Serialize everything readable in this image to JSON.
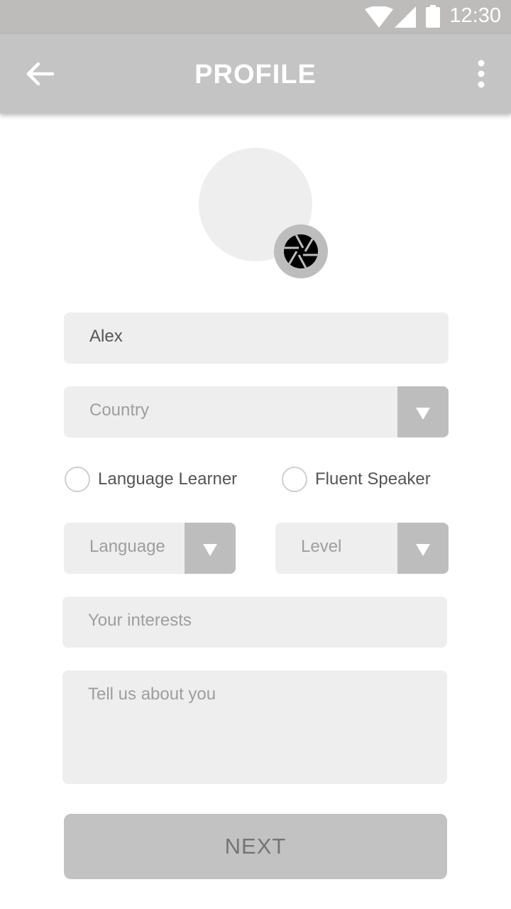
{
  "status_bar": {
    "time": "12:30",
    "icons": [
      "wifi-icon",
      "cell-signal-icon",
      "battery-icon"
    ]
  },
  "app_bar": {
    "title": "PROFILE",
    "back_icon": "arrow-back-icon",
    "menu_icon": "more-vert-icon"
  },
  "profile": {
    "avatar": "avatar-placeholder",
    "camera_icon": "camera-aperture-icon"
  },
  "form": {
    "name_value": "Alex",
    "country_placeholder": "Country",
    "role_options": [
      {
        "label": "Language Learner",
        "selected": false
      },
      {
        "label": "Fluent Speaker",
        "selected": false
      }
    ],
    "language_placeholder": "Language",
    "level_placeholder": "Level",
    "interests_placeholder": "Your interests",
    "about_placeholder": "Tell us about you",
    "dropdown_icon": "triangle-down-icon"
  },
  "actions": {
    "next_label": "NEXT"
  },
  "colors": {
    "status_bar": "#bdbcbb",
    "app_bar": "#c4c4c4",
    "field_bg": "#eeeeee",
    "dropdown_button": "#bdbdbd",
    "next_button": "#c2c2c2"
  }
}
